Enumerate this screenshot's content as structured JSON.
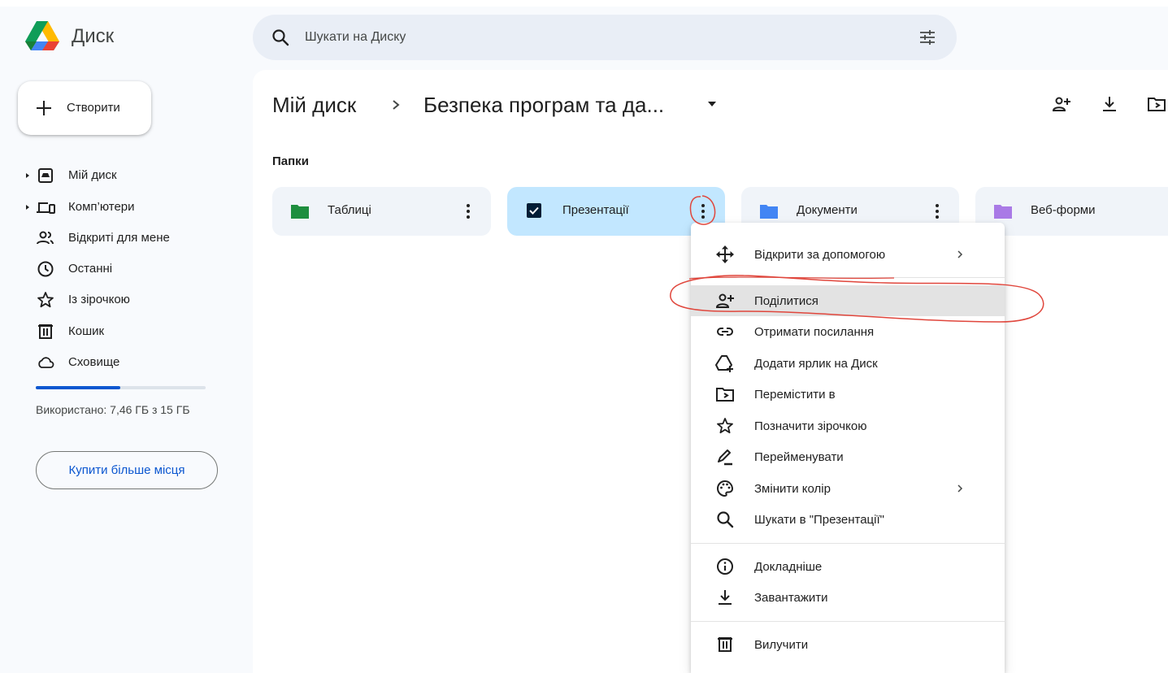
{
  "app": {
    "title": "Диск",
    "colors": {
      "accent": "#0b57d0",
      "selected_folder": "#c2e7ff",
      "annotation": "#e0463c"
    }
  },
  "search": {
    "placeholder": "Шукати на Диску",
    "icon": "search-icon",
    "filter_icon": "tune-icon"
  },
  "sidebar": {
    "create_label": "Створити",
    "items": [
      {
        "label": "Мій диск",
        "icon": "my-drive-icon",
        "expandable": true
      },
      {
        "label": "Комп’ютери",
        "icon": "computers-icon",
        "expandable": true
      },
      {
        "label": "Відкриті для мене",
        "icon": "shared-icon",
        "expandable": false
      },
      {
        "label": "Останні",
        "icon": "clock-icon",
        "expandable": false
      },
      {
        "label": "Із зірочкою",
        "icon": "star-icon",
        "expandable": false
      },
      {
        "label": "Кошик",
        "icon": "trash-icon",
        "expandable": false
      },
      {
        "label": "Сховище",
        "icon": "cloud-icon",
        "expandable": false
      }
    ],
    "storage_text": "Використано: 7,46 ГБ з 15 ГБ",
    "storage_used_fraction": 0.497,
    "buy_label": "Купити більше місця"
  },
  "breadcrumb": {
    "root": "Мій диск",
    "current": "Безпека програм та да..."
  },
  "header_icons": [
    "share-icon",
    "download-icon",
    "move-icon"
  ],
  "folders_section_title": "Папки",
  "folders": [
    {
      "name": "Таблиці",
      "color": "#1e8e3e",
      "selected": false
    },
    {
      "name": "Презентації",
      "color": "#5f6368",
      "selected": true
    },
    {
      "name": "Документи",
      "color": "#4285f4",
      "selected": false
    },
    {
      "name": "Веб-форми",
      "color": "#a97ae6",
      "selected": false
    }
  ],
  "menu": {
    "items": [
      {
        "label": "Відкрити за допомогою",
        "icon": "open-with-icon",
        "submenu": true
      },
      {
        "label": "Поділитися",
        "icon": "share-icon",
        "submenu": false,
        "highlighted": true
      },
      {
        "label": "Отримати посилання",
        "icon": "link-icon",
        "submenu": false
      },
      {
        "label": "Додати ярлик на Диск",
        "icon": "add-shortcut-icon",
        "submenu": false
      },
      {
        "label": "Перемістити в",
        "icon": "move-icon",
        "submenu": false
      },
      {
        "label": "Позначити зірочкою",
        "icon": "star-icon",
        "submenu": false
      },
      {
        "label": "Перейменувати",
        "icon": "rename-icon",
        "submenu": false
      },
      {
        "label": "Змінити колір",
        "icon": "palette-icon",
        "submenu": true
      },
      {
        "label": "Шукати в \"Презентації\"",
        "icon": "search-icon",
        "submenu": false
      },
      {
        "label": "Докладніше",
        "icon": "info-icon",
        "submenu": false
      },
      {
        "label": "Завантажити",
        "icon": "download-icon",
        "submenu": false
      },
      {
        "label": "Вилучити",
        "icon": "trash-icon",
        "submenu": false
      }
    ]
  }
}
